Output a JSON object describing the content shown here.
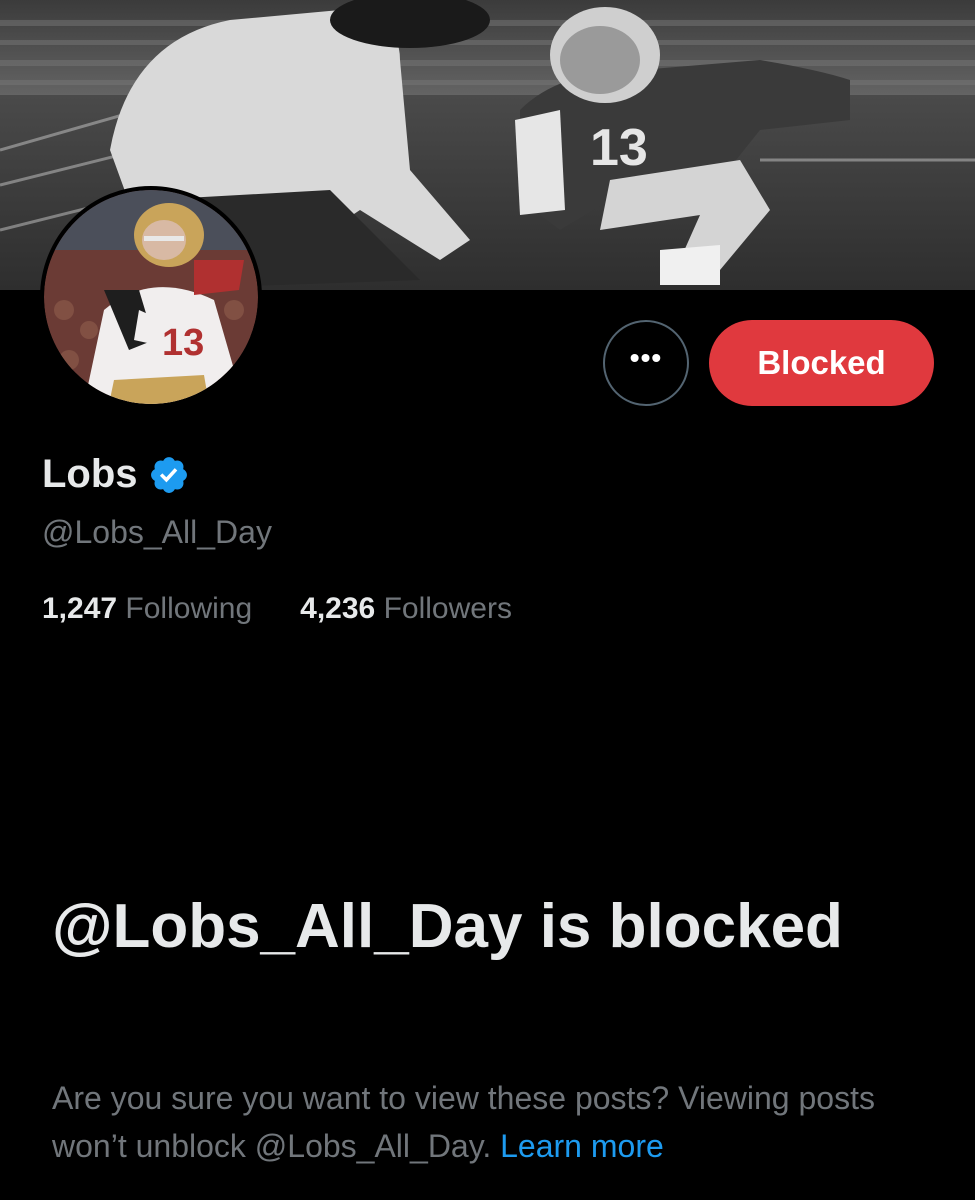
{
  "profile": {
    "display_name": "Lobs",
    "handle": "@Lobs_All_Day",
    "verified": true,
    "verified_icon": "verified-badge-icon",
    "stats": {
      "following_count": "1,247",
      "following_label": "Following",
      "followers_count": "4,236",
      "followers_label": "Followers"
    }
  },
  "actions": {
    "more_label": "•••",
    "more_icon": "more-options-icon",
    "blocked_label": "Blocked"
  },
  "blocked_notice": {
    "title": "@Lobs_All_Day is blocked",
    "description": "Are you sure you want to view these posts? Viewing posts won’t unblock @Lobs_All_Day.",
    "link_label": "Learn more"
  },
  "colors": {
    "background": "#000000",
    "blocked_button": "#e0393e",
    "link": "#1d9bf0",
    "verified": "#1d9bf0",
    "secondary_text": "#71767b",
    "primary_text": "#e7e9ea"
  }
}
